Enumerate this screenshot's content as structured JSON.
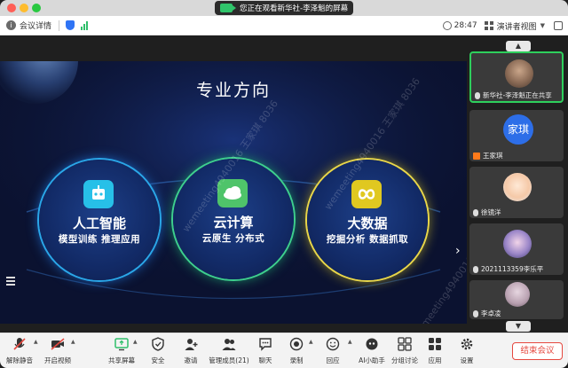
{
  "titlebar": {
    "share_notice": "您正在观看新华社-李泽魁的屏幕"
  },
  "infobar": {
    "meeting_details": "会议详情",
    "time": "28:47",
    "view_mode": "演讲者视图"
  },
  "slide": {
    "title": "专业方向",
    "watermark": "wemeeting4940016 王家琪 8036",
    "circles": [
      {
        "title": "人工智能",
        "subtitle": "模型训练 推理应用",
        "icon": "robot-icon",
        "ring_color": "#2aa7e8"
      },
      {
        "title": "云计算",
        "subtitle": "云原生 分布式",
        "icon": "cloud-icon",
        "ring_color": "#3ecf8e"
      },
      {
        "title": "大数据",
        "subtitle": "挖掘分析 数据抓取",
        "icon": "infinity-icon",
        "ring_color": "#e8d64a"
      }
    ]
  },
  "panel": {
    "participants": [
      {
        "name": "新华社-李泽魁正在共享",
        "avatar": "photo",
        "active": true
      },
      {
        "name": "王家琪",
        "avatar": "家琪",
        "host": true
      },
      {
        "name": "徐镜洋",
        "avatar": "cartoon"
      },
      {
        "name": "2021113359李乐平",
        "avatar": "anime"
      },
      {
        "name": "李卓凌",
        "avatar": "photo"
      }
    ]
  },
  "toolbar": {
    "items": [
      {
        "label": "解除静音",
        "icon": "mic-muted-icon"
      },
      {
        "label": "开启视频",
        "icon": "video-off-icon"
      },
      {
        "label": "共享屏幕",
        "icon": "share-screen-icon"
      },
      {
        "label": "安全",
        "icon": "shield-icon"
      },
      {
        "label": "邀请",
        "icon": "invite-icon"
      },
      {
        "label": "管理成员(21)",
        "icon": "members-icon"
      },
      {
        "label": "聊天",
        "icon": "chat-icon"
      },
      {
        "label": "录制",
        "icon": "record-icon"
      },
      {
        "label": "回应",
        "icon": "reaction-icon"
      },
      {
        "label": "AI小助手",
        "icon": "ai-assistant-icon"
      },
      {
        "label": "分组讨论",
        "icon": "breakout-icon"
      },
      {
        "label": "应用",
        "icon": "apps-icon"
      },
      {
        "label": "设置",
        "icon": "settings-icon"
      }
    ],
    "end_meeting": "结束会议"
  },
  "colors": {
    "accent_blue": "#2f74f5",
    "end_red": "#e5483f",
    "active_green": "#2ecf5c"
  }
}
